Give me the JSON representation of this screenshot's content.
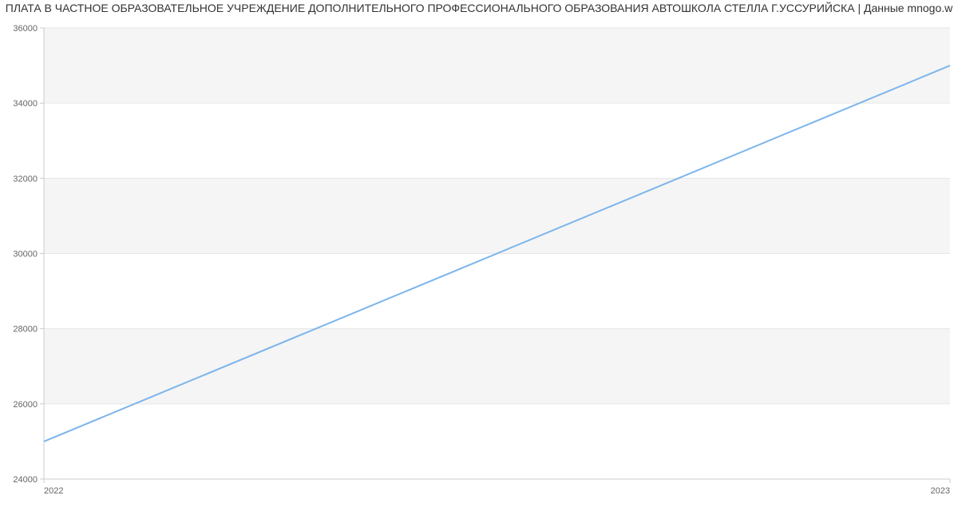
{
  "chart_data": {
    "type": "line",
    "title": "ПЛАТА В ЧАСТНОЕ ОБРАЗОВАТЕЛЬНОЕ УЧРЕЖДЕНИЕ ДОПОЛНИТЕЛЬНОГО ПРОФЕССИОНАЛЬНОГО ОБРАЗОВАНИЯ АВТОШКОЛА СТЕЛЛА Г.УССУРИЙСКА | Данные mnogo.w",
    "x": [
      2022,
      2023
    ],
    "values": [
      25000,
      35000
    ],
    "x_ticks": [
      "2022",
      "2023"
    ],
    "y_ticks": [
      24000,
      26000,
      28000,
      30000,
      32000,
      34000,
      36000
    ],
    "ylim": [
      24000,
      36000
    ],
    "xlabel": "",
    "ylabel": "",
    "line_color": "#7cb5ec",
    "grid_alternating": true
  }
}
